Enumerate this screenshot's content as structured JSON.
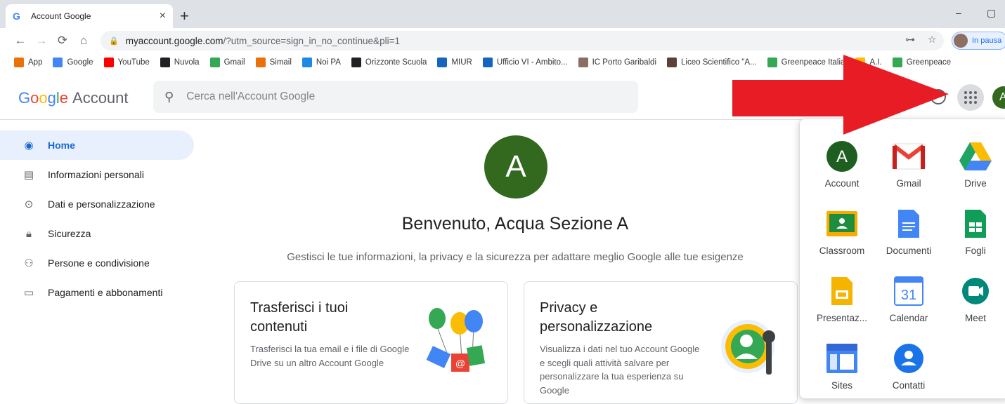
{
  "browser": {
    "tab_title": "Account Google",
    "tab_close": "×",
    "new_tab": "+",
    "url_host": "myaccount.google.com",
    "url_path": "/?utm_source=sign_in_no_continue&pli=1",
    "profile_label": "In pausa",
    "minimize": "–",
    "maximize": "▢"
  },
  "bookmarks": [
    {
      "label": "App",
      "icon": "apps-grid-icon",
      "color": "#e8710a"
    },
    {
      "label": "Google",
      "icon": "google-g-icon",
      "color": "#4285f4"
    },
    {
      "label": "YouTube",
      "icon": "youtube-icon",
      "color": "#ff0000"
    },
    {
      "label": "Nuvola",
      "icon": "cloud-icon",
      "color": "#202124"
    },
    {
      "label": "Gmail",
      "icon": "google-g-icon",
      "color": "#34a853"
    },
    {
      "label": "Simail",
      "icon": "simail-icon",
      "color": "#e8710a"
    },
    {
      "label": "Noi PA",
      "icon": "noipa-icon",
      "color": "#1e88e5"
    },
    {
      "label": "Orizzonte Scuola",
      "icon": "orizzonte-icon",
      "color": "#202124"
    },
    {
      "label": "MIUR",
      "icon": "miur-icon",
      "color": "#1565c0"
    },
    {
      "label": "Ufficio VI - Ambito...",
      "icon": "fe-icon",
      "color": "#1565c0"
    },
    {
      "label": "IC Porto Garibaldi",
      "icon": "emblem-icon",
      "color": "#8d6e63"
    },
    {
      "label": "Liceo Scientifico \"A...",
      "icon": "emblem-icon",
      "color": "#5d4037"
    },
    {
      "label": "Greenpeace Italia",
      "icon": "google-g-icon",
      "color": "#34a853"
    },
    {
      "label": "A.I.",
      "icon": "ai-icon",
      "color": "#fbbc04"
    },
    {
      "label": "Greenpeace",
      "icon": "greenpeace-icon",
      "color": "#34a853"
    }
  ],
  "header": {
    "logo_google": "Google",
    "logo_account": "Account",
    "search_placeholder": "Cerca nell'Account Google",
    "avatar_letter": "A"
  },
  "sidebar": {
    "items": [
      {
        "label": "Home",
        "icon": "account-circle-icon",
        "active": true
      },
      {
        "label": "Informazioni personali",
        "icon": "id-card-icon",
        "active": false
      },
      {
        "label": "Dati e personalizzazione",
        "icon": "toggle-icon",
        "active": false
      },
      {
        "label": "Sicurezza",
        "icon": "lock-icon",
        "active": false
      },
      {
        "label": "Persone e condivisione",
        "icon": "people-icon",
        "active": false
      },
      {
        "label": "Pagamenti e abbonamenti",
        "icon": "credit-card-icon",
        "active": false
      }
    ]
  },
  "main": {
    "avatar_letter": "A",
    "welcome": "Benvenuto, Acqua Sezione A",
    "subtitle": "Gestisci le tue informazioni, la privacy e la sicurezza per adattare meglio Google alle tue esigenze",
    "cards": [
      {
        "title": "Trasferisci i tuoi contenuti",
        "body": "Trasferisci la tua email e i file di Google Drive su un altro Account Google"
      },
      {
        "title": "Privacy e personalizzazione",
        "body": "Visualizza i dati nel tuo Account Google e scegli quali attività salvare per personalizzare la tua esperienza su Google"
      }
    ]
  },
  "apps_panel": {
    "apps": [
      {
        "label": "Account",
        "icon": "account-app-icon"
      },
      {
        "label": "Gmail",
        "icon": "gmail-icon"
      },
      {
        "label": "Drive",
        "icon": "drive-icon"
      },
      {
        "label": "Classroom",
        "icon": "classroom-icon"
      },
      {
        "label": "Documenti",
        "icon": "docs-icon"
      },
      {
        "label": "Fogli",
        "icon": "sheets-icon"
      },
      {
        "label": "Presentaz...",
        "icon": "slides-icon"
      },
      {
        "label": "Calendar",
        "icon": "calendar-icon",
        "day": "31"
      },
      {
        "label": "Meet",
        "icon": "meet-icon"
      },
      {
        "label": "Sites",
        "icon": "sites-icon"
      },
      {
        "label": "Contatti",
        "icon": "contacts-icon"
      }
    ]
  },
  "colors": {
    "annotation_arrow": "#e81c24",
    "avatar_green": "#33691e",
    "active_blue": "#1967d2"
  }
}
